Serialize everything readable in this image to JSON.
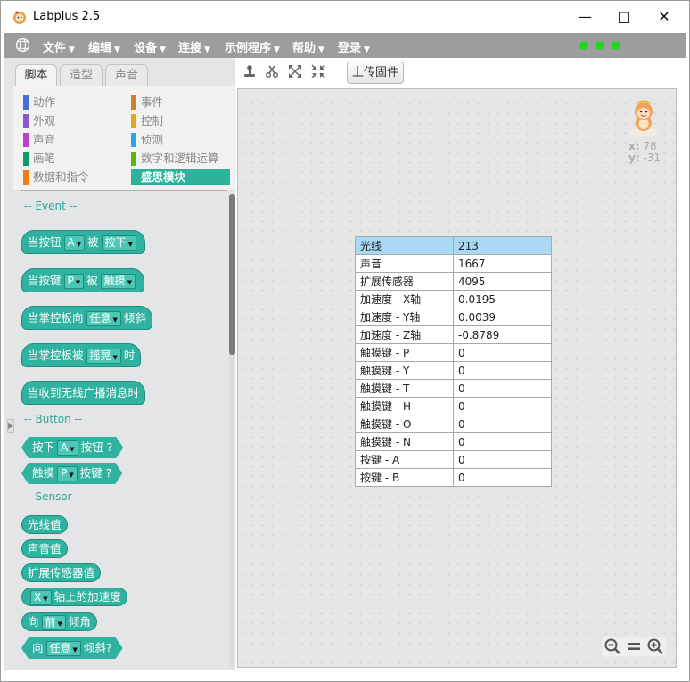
{
  "window": {
    "title": "Labplus 2.5"
  },
  "menubar": {
    "items": [
      {
        "label": "文件"
      },
      {
        "label": "编辑"
      },
      {
        "label": "设备"
      },
      {
        "label": "连接"
      },
      {
        "label": "示例程序"
      },
      {
        "label": "帮助"
      },
      {
        "label": "登录"
      }
    ],
    "status_leds": 3,
    "led_color": "#22d422"
  },
  "tabs": [
    {
      "label": "脚本",
      "active": true
    },
    {
      "label": "造型",
      "active": false
    },
    {
      "label": "声音",
      "active": false
    }
  ],
  "toolbar": {
    "upload_label": "上传固件"
  },
  "categories": {
    "left": [
      {
        "label": "动作",
        "color": "#4a6cd4"
      },
      {
        "label": "外观",
        "color": "#8a55d7"
      },
      {
        "label": "声音",
        "color": "#bb42c3"
      },
      {
        "label": "画笔",
        "color": "#0e9a6c"
      },
      {
        "label": "数据和指令",
        "color": "#ee7d16"
      }
    ],
    "right": [
      {
        "label": "事件",
        "color": "#c88330"
      },
      {
        "label": "控制",
        "color": "#e1a91a"
      },
      {
        "label": "侦测",
        "color": "#2ca5e2"
      },
      {
        "label": "数字和逻辑运算",
        "color": "#5cb712"
      },
      {
        "label": "盛思模块",
        "color": "#2bb39c",
        "selected": true
      }
    ]
  },
  "palette": {
    "section_event": "-- Event --",
    "section_button": "-- Button --",
    "section_sensor": "-- Sensor --",
    "blocks": {
      "b1_text": "当按钮",
      "b1_dd1": "A",
      "b1_mid": "被",
      "b1_dd2": "按下",
      "b2_text": "当按键",
      "b2_dd1": "P",
      "b2_mid": "被",
      "b2_dd2": "触摸",
      "b3_text": "当掌控板向",
      "b3_dd1": "任意",
      "b3_end": "倾斜",
      "b4_text": "当掌控板被",
      "b4_dd1": "摇晃",
      "b4_end": "时",
      "b5_text": "当收到无线广播消息时",
      "b6_text": "按下",
      "b6_dd1": "A",
      "b6_end": "按钮 ?",
      "b7_text": "触摸",
      "b7_dd1": "P",
      "b7_end": "按键 ?",
      "b8_text": "光线值",
      "b9_text": "声音值",
      "b10_text": "扩展传感器值",
      "b11_dd1": "X",
      "b11_end": "轴上的加速度",
      "b12_text": "向",
      "b12_dd1": "前",
      "b12_end": "倾角",
      "b13_text": "向",
      "b13_dd1": "任意",
      "b13_end": "倾斜?"
    }
  },
  "stage": {
    "sprite_x_label": "x:",
    "sprite_x": "78",
    "sprite_y_label": "y:",
    "sprite_y": "-31",
    "sensors": [
      {
        "name": "光线",
        "value": "213"
      },
      {
        "name": "声音",
        "value": "1667"
      },
      {
        "name": "扩展传感器",
        "value": "4095"
      },
      {
        "name": "加速度 - X轴",
        "value": "0.0195"
      },
      {
        "name": "加速度 - Y轴",
        "value": "0.0039"
      },
      {
        "name": "加速度 - Z轴",
        "value": "-0.8789"
      },
      {
        "name": "触摸键 - P",
        "value": "0"
      },
      {
        "name": "触摸键 - Y",
        "value": "0"
      },
      {
        "name": "触摸键 - T",
        "value": "0"
      },
      {
        "name": "触摸键 - H",
        "value": "0"
      },
      {
        "name": "触摸键 - O",
        "value": "0"
      },
      {
        "name": "触摸键 - N",
        "value": "0"
      },
      {
        "name": "按键 - A",
        "value": "0"
      },
      {
        "name": "按键 - B",
        "value": "0"
      }
    ],
    "zoom_controls": [
      "zoom-out-icon",
      "zoom-reset-icon",
      "zoom-in-icon"
    ]
  }
}
